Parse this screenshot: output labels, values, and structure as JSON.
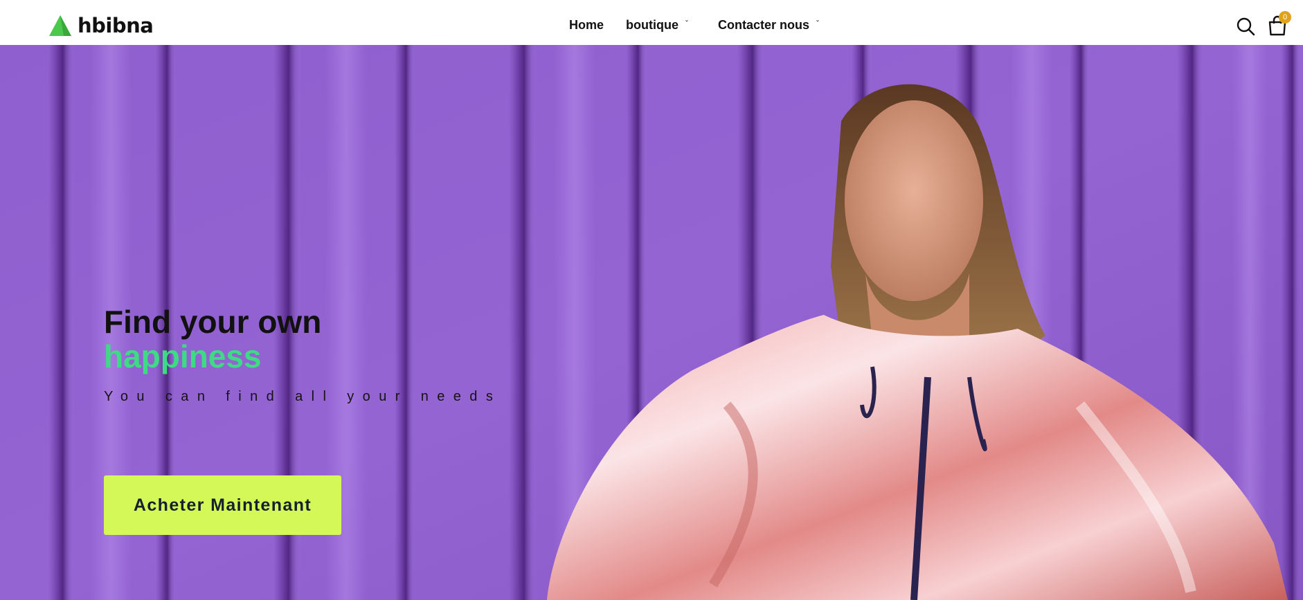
{
  "brand": {
    "name": "hbibna",
    "accent_color": "#4cc94c"
  },
  "nav": {
    "items": [
      {
        "label": "Home",
        "has_dropdown": false
      },
      {
        "label": "boutique",
        "has_dropdown": true
      },
      {
        "label": "Contacter nous",
        "has_dropdown": true
      }
    ]
  },
  "header_icons": {
    "search": {
      "icon": "search-icon"
    },
    "cart": {
      "icon": "shopping-bag-icon",
      "count": "0",
      "badge_color": "#e0a11b"
    }
  },
  "hero": {
    "title_line1": "Find your own",
    "title_line2": "happiness",
    "title_accent_color": "#3ddc84",
    "subtitle": "You can find all your needs",
    "cta_label": "Acheter Maintenant",
    "cta_color": "#d3f858",
    "background_color": "#8d5cc9"
  }
}
